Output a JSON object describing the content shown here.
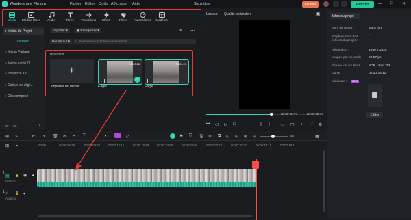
{
  "window": {
    "app_name": "Wondershare Filmora",
    "menus": [
      "Fichier",
      "Editer",
      "Outils",
      "Affichage",
      "Aide"
    ],
    "doc_title": "Sans titre",
    "buy_label": "Acheter",
    "export_label": "Exporter"
  },
  "toolbar_tabs": [
    {
      "label": "Média",
      "icon": "media-icon",
      "active": true
    },
    {
      "label": "Médias libres",
      "icon": "stock-media-icon",
      "active": false
    },
    {
      "label": "Audio",
      "icon": "music-note-icon",
      "active": false
    },
    {
      "label": "Titres",
      "icon": "titles-icon",
      "active": false
    },
    {
      "label": "Transitions",
      "icon": "transitions-icon",
      "active": false
    },
    {
      "label": "Effets",
      "icon": "effects-icon",
      "active": false
    },
    {
      "label": "Filtres",
      "icon": "filters-icon",
      "active": false
    },
    {
      "label": "Autocollants",
      "icon": "stickers-icon",
      "active": false
    },
    {
      "label": "Modèles",
      "icon": "templates-icon",
      "active": false
    }
  ],
  "left_panel": {
    "project_media": "Média de Projet",
    "folder": "Dossier",
    "items": [
      "Média Partagé",
      "Média sur le Cl...",
      "Influence Kit",
      "Calque de régl...",
      "Clip composé"
    ]
  },
  "media_toolbar": {
    "import_label": "Importer",
    "record_label": "Enregistrer",
    "sort_label": "Par défaut",
    "search_placeholder": "Recherche de fichiers multimédia"
  },
  "media_area": {
    "folder_label": "DOSSIER",
    "import_card_label": "Importer un média",
    "clips": [
      {
        "name": "Eagle",
        "duration": "00:00:26"
      },
      {
        "name": "Eagle",
        "duration": "00:00:26"
      }
    ]
  },
  "preview": {
    "player_label": "Lecteur",
    "quality_label": "Qualité optimale",
    "current_time": "00:00:39:12",
    "total_time": "00:00:39:12",
    "progress": 0.56
  },
  "project_info": {
    "tab_label": "Infos du projet",
    "fields": [
      {
        "label": "Nom du projet :",
        "value": "Sans titre"
      },
      {
        "label": "Emplacement des fichiers du projet :",
        "value": "/"
      },
      {
        "label": "Résolution :",
        "value": "1080 x 1920"
      },
      {
        "label": "Images par seconde :",
        "value": "23.97fps"
      },
      {
        "label": "Espace de couleurs :",
        "value": "SDR - Rec.709"
      },
      {
        "label": "Durée :",
        "value": "00:00:39:12"
      }
    ],
    "thumbnail_label": "Miniature :",
    "thumbnail_badge": "NEW",
    "edit_label": "Éditer"
  },
  "timeline": {
    "ticks": [
      "00:00",
      "00:00:04:25",
      "00:00:09:20",
      "00:00:14:15",
      "00:00:19:10",
      "00:00:24:05",
      "00:00:29:00",
      "00:00:33:25",
      "00:00:38:21",
      "00:00:43:16",
      "00:00:48:11"
    ],
    "video_track_label": "Vidéo 1",
    "audio_track_label": "Audio 1",
    "video_track_num": "1",
    "audio_track_num": "1"
  },
  "colors": {
    "accent": "#2fd6b3",
    "highlight_box": "#e23a36",
    "playhead": "#ff4a4a",
    "export_button": "#27c79c",
    "buy_button": "#e8734a"
  }
}
